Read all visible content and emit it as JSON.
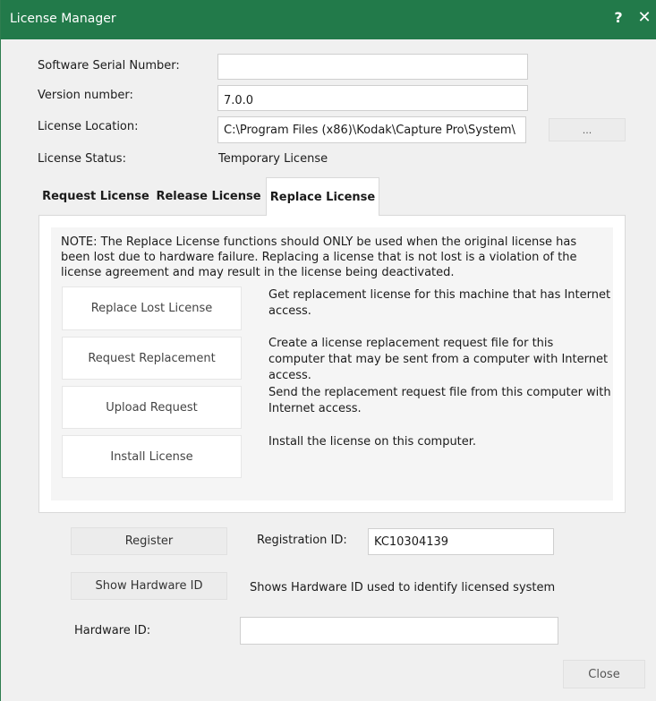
{
  "window": {
    "title": "License Manager",
    "help_label": "?",
    "close_label": "✕"
  },
  "fields": {
    "serial": {
      "label": "Software Serial Number:",
      "value": ""
    },
    "version": {
      "label": "Version number:",
      "value": "7.0.0"
    },
    "location": {
      "label": "License Location:",
      "value": "C:\\Program Files (x86)\\Kodak\\Capture Pro\\System\\",
      "browse_label": "..."
    },
    "status": {
      "label": "License Status:",
      "value": "Temporary License"
    }
  },
  "tabs": [
    {
      "label": "Request License",
      "active": false
    },
    {
      "label": "Release License",
      "active": false
    },
    {
      "label": "Replace License",
      "active": true
    }
  ],
  "replace_panel": {
    "note": "NOTE: The Replace License functions should ONLY be used when the original license has been lost due to hardware failure. Replacing a license that is not lost is a violation of the license agreement and may result in the license being deactivated.",
    "actions": [
      {
        "button": "Replace Lost License",
        "description": "Get replacement license for this machine that has Internet access."
      },
      {
        "button": "Request Replacement",
        "description": "Create a license replacement request file for this computer that may be sent from a computer with Internet access."
      },
      {
        "button": "Upload Request",
        "description": "Send the replacement request file from this computer with Internet access."
      },
      {
        "button": "Install License",
        "description": "Install the license on this computer."
      }
    ]
  },
  "registration": {
    "register_label": "Register",
    "id_label": "Registration ID:",
    "id_value": "KC10304139"
  },
  "hardware": {
    "show_label": "Show Hardware ID",
    "show_description": "Shows Hardware ID used to identify licensed system",
    "id_label": "Hardware ID:",
    "id_value": ""
  },
  "footer": {
    "close_label": "Close"
  },
  "colors": {
    "title_bar": "#227a4a",
    "dialog_bg": "#f0f0f0",
    "panel_bg": "#ffffff",
    "inner_panel_bg": "#f5f5f5"
  }
}
